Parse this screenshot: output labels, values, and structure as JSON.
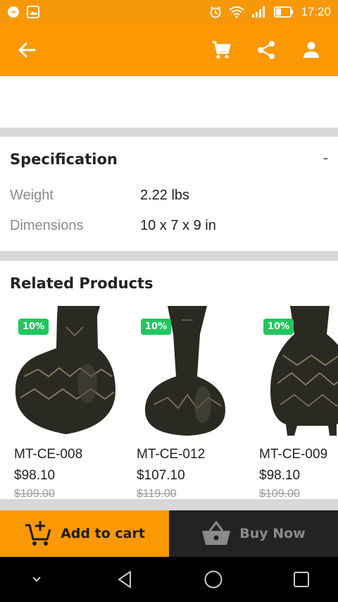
{
  "status_bar": {
    "time": "17:20",
    "icons": [
      "messenger-icon",
      "gallery-icon",
      "alarm-icon",
      "wifi-icon",
      "signal-icon",
      "battery-icon"
    ]
  },
  "app_bar": {
    "background": "#fb9804",
    "icons": [
      "back-arrow-icon",
      "cart-icon",
      "share-icon",
      "account-icon"
    ]
  },
  "specification": {
    "title": "Specification",
    "toggle": "-",
    "rows": [
      {
        "label": "Weight",
        "value": "2.22 lbs"
      },
      {
        "label": "Dimensions",
        "value": "10 x 7 x 9 in"
      }
    ]
  },
  "related": {
    "title": "Related Products",
    "items": [
      {
        "badge": "10%",
        "sku": "MT-CE-008",
        "price": "$98.10",
        "old_price": "$109.00"
      },
      {
        "badge": "10%",
        "sku": "MT-CE-012",
        "price": "$107.10",
        "old_price": "$119.00"
      },
      {
        "badge": "10%",
        "sku": "MT-CE-009",
        "price": "$98.10",
        "old_price": "$109.00"
      }
    ]
  },
  "actions": {
    "add_to_cart": "Add to cart",
    "buy_now": "Buy Now"
  },
  "colors": {
    "accent": "#fb9804",
    "badge": "#22c55e",
    "buy_bg": "#232323"
  },
  "nav": {
    "icons": [
      "collapse-chevron-icon",
      "back-triangle-icon",
      "home-circle-icon",
      "recents-square-icon"
    ]
  }
}
